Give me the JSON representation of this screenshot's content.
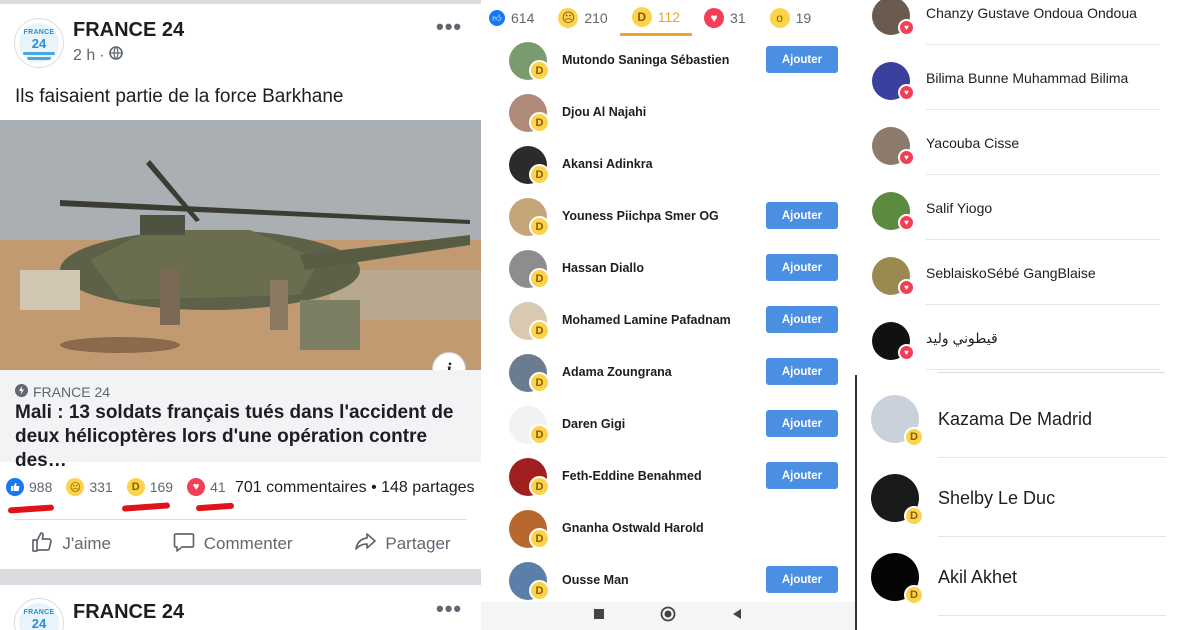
{
  "post": {
    "page_name": "FRANCE 24",
    "logo_text_top": "FRANCE",
    "logo_text_num": "24",
    "time": "2 h",
    "caption": "Ils faisaient partie de la force Barkhane",
    "link_source": "FRANCE 24",
    "link_title": "Mali : 13 soldats français tués dans l'accident de deux hélicoptères lors d'une opération contre des…",
    "reactions": {
      "like": "988",
      "sad": "331",
      "haha": "169",
      "love": "41"
    },
    "comments": "701 commentaires",
    "shares": "148 partages",
    "actions": {
      "like": "J'aime",
      "comment": "Commenter",
      "share": "Partager"
    },
    "next_page_name": "FRANCE 24"
  },
  "reactions_list": {
    "tabs": [
      {
        "icon": "like-icon",
        "count": "614"
      },
      {
        "icon": "sad-icon",
        "count": "210"
      },
      {
        "icon": "haha-icon",
        "count": "112"
      },
      {
        "icon": "love-icon",
        "count": "31"
      },
      {
        "icon": "wow-icon",
        "count": "19"
      }
    ],
    "add_label": "Ajouter",
    "people": [
      {
        "name": "Mutondo Saninga Sébastien",
        "add": true,
        "color": "#7a9b6e"
      },
      {
        "name": "Djou Al Najahi",
        "add": false,
        "color": "#b08a78"
      },
      {
        "name": "Akansi Adinkra",
        "add": false,
        "color": "#2b2b2b"
      },
      {
        "name": "Youness Piichpa Smer OG",
        "add": true,
        "color": "#c7a57a"
      },
      {
        "name": "Hassan Diallo",
        "add": true,
        "color": "#8d8d8d"
      },
      {
        "name": "Mohamed Lamine Pafadnam",
        "add": true,
        "color": "#d9c9b0"
      },
      {
        "name": "Adama Zoungrana",
        "add": true,
        "color": "#6b7c8f"
      },
      {
        "name": "Daren Gigi",
        "add": true,
        "color": "#f2f2f2"
      },
      {
        "name": "Feth-Eddine Benahmed",
        "add": true,
        "color": "#a02020"
      },
      {
        "name": "Gnanha Ostwald Harold",
        "add": false,
        "color": "#b8672e"
      },
      {
        "name": "Ousse Man",
        "add": true,
        "color": "#5a7fa8"
      }
    ]
  },
  "love_list": [
    {
      "name": "Chanzy Gustave Ondoua Ondoua",
      "color": "#6b5a4e"
    },
    {
      "name": "Bilima Bunne Muhammad Bilima",
      "color": "#3b3f9e"
    },
    {
      "name": "Yacouba Cisse",
      "color": "#8c7a6a"
    },
    {
      "name": "Salif Yiogo",
      "color": "#5c8a3e"
    },
    {
      "name": "SeblaiskoSébé GangBlaise",
      "color": "#9a8a50"
    },
    {
      "name": "قيطوني وليد",
      "color": "#111111"
    }
  ],
  "haha_list_large": [
    {
      "name": "Kazama De Madrid",
      "color": "#c9d2da"
    },
    {
      "name": "Shelby Le Duc",
      "color": "#1a1a1a"
    },
    {
      "name": "Akil Akhet",
      "color": "#050505"
    }
  ]
}
